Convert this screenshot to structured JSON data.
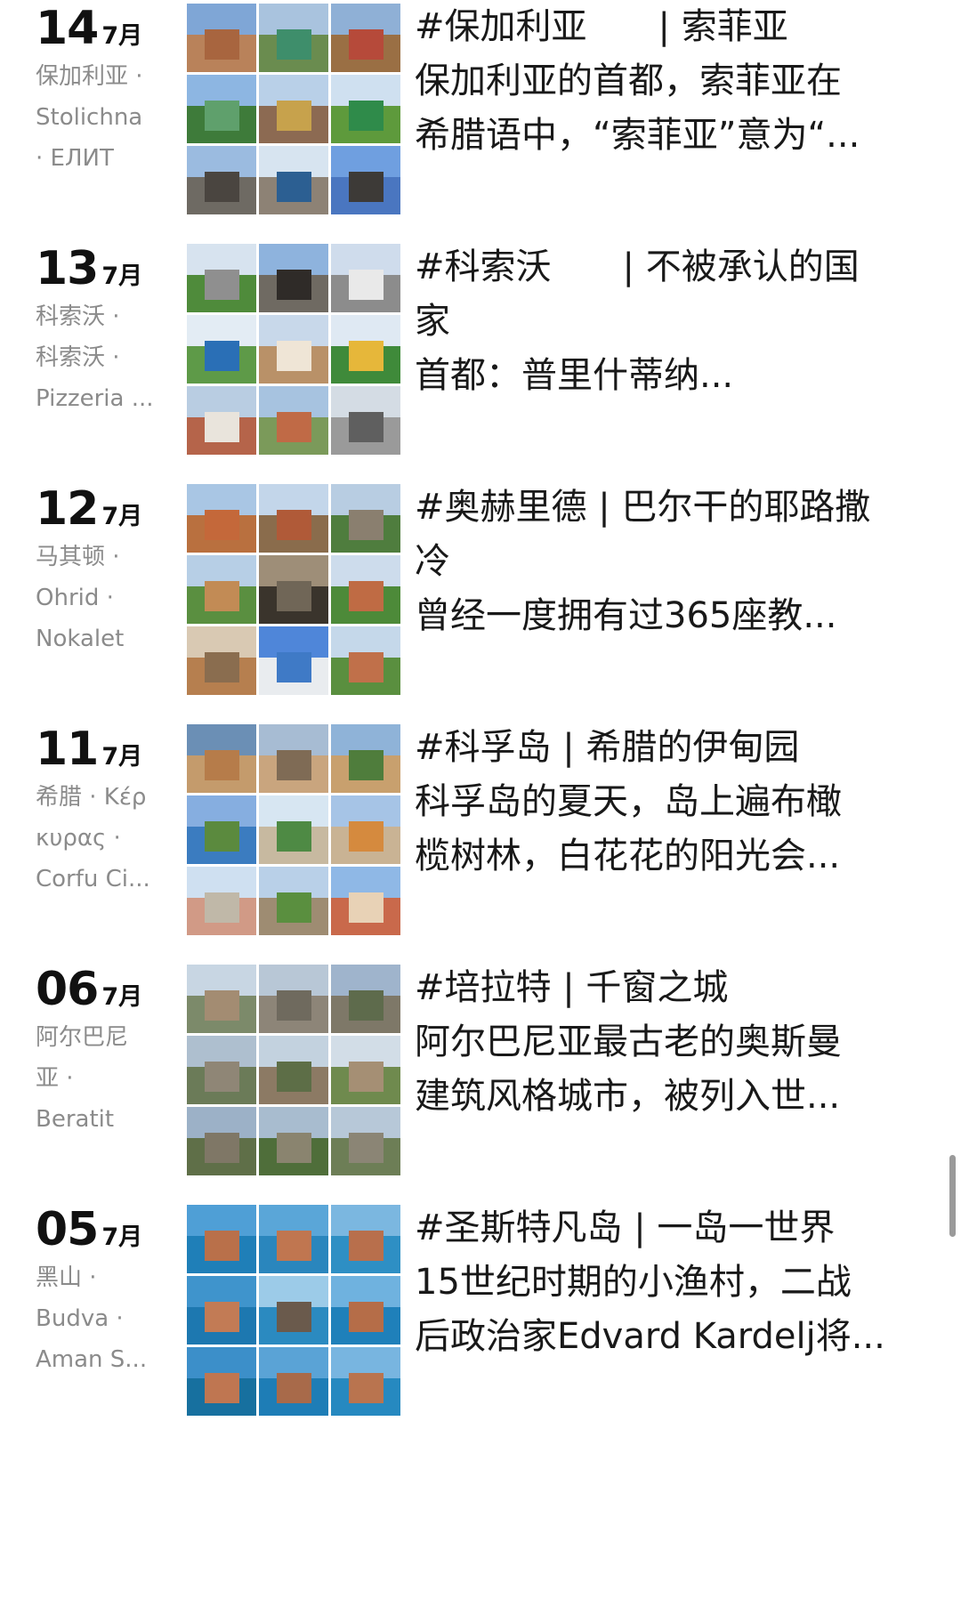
{
  "entries": [
    {
      "day": "14",
      "month": "7月",
      "location_lines": [
        "保加利亚 ·",
        "Stolichna",
        "· ЕЛИТ"
      ],
      "text_lines": [
        "#保加利亚　　| 索菲亚",
        "保加利亚的首都，索菲亚在",
        "希腊语中，“索菲亚”意为“..."
      ],
      "thumb_palette": [
        [
          "#7fa6d6",
          "#b9825a",
          "#a8653f"
        ],
        [
          "#a9c3de",
          "#6a8c4f",
          "#3e8e6b"
        ],
        [
          "#8fb0d6",
          "#9a6f44",
          "#b64a3a"
        ],
        [
          "#8db6e2",
          "#3e7b3a",
          "#5fa06c"
        ],
        [
          "#b9d0e8",
          "#8c6a52",
          "#c7a24c"
        ],
        [
          "#cfe0f0",
          "#5e9a3c",
          "#2f8b4a"
        ],
        [
          "#9bbbe0",
          "#6e6a63",
          "#4a4540"
        ],
        [
          "#d7e4f0",
          "#8d8275",
          "#2c5f92"
        ],
        [
          "#6f9fe0",
          "#4a76c0",
          "#3d3a37"
        ]
      ]
    },
    {
      "day": "13",
      "month": "7月",
      "location_lines": [
        "科索沃 ·",
        "科索沃 ·",
        "Pizzeria ..."
      ],
      "text_lines": [
        "#科索沃　　| 不被承认的国",
        "家",
        "首都：普里什蒂纳..."
      ],
      "thumb_palette": [
        [
          "#d7e3ef",
          "#4f8b3b",
          "#8f8f8f"
        ],
        [
          "#8eb3dd",
          "#6f6a62",
          "#2f2b28"
        ],
        [
          "#cfdcec",
          "#8c8c8c",
          "#e9e9e9"
        ],
        [
          "#e3ecf4",
          "#5e9a48",
          "#2a6fb6"
        ],
        [
          "#c8d8ea",
          "#b99168",
          "#efe5d6"
        ],
        [
          "#dfe9f3",
          "#3f8a3a",
          "#e6b73a"
        ],
        [
          "#b9cde2",
          "#b5644a",
          "#e9e4dc"
        ],
        [
          "#a7c3e0",
          "#7b9a5a",
          "#c06a46"
        ],
        [
          "#d4dce4",
          "#9a9a9a",
          "#5f5f5f"
        ]
      ]
    },
    {
      "day": "12",
      "month": "7月",
      "location_lines": [
        "马其顿 ·",
        "Ohrid ·",
        "Nokalet"
      ],
      "text_lines": [
        "#奥赫里德 | 巴尔干的耶路撒",
        "冷",
        "曾经一度拥有过365座教..."
      ],
      "thumb_palette": [
        [
          "#a9c6e4",
          "#b9703f",
          "#c4683a"
        ],
        [
          "#c3d6ea",
          "#8a6c4c",
          "#b05a38"
        ],
        [
          "#b8cde2",
          "#4f7d3e",
          "#8a7f6f"
        ],
        [
          "#b7cfe6",
          "#5a8f40",
          "#c28b55"
        ],
        [
          "#9e8e78",
          "#3a342c",
          "#706657"
        ],
        [
          "#cddcec",
          "#4d8a39",
          "#bf6b44"
        ],
        [
          "#d9c9b3",
          "#b67f4f",
          "#8a6d4f"
        ],
        [
          "#4f86d9",
          "#e9ecef",
          "#3f7ac6"
        ],
        [
          "#c5d8ea",
          "#5a8f3f",
          "#c0704a"
        ]
      ]
    },
    {
      "day": "11",
      "month": "7月",
      "location_lines": [
        "希腊 · Κέρ",
        "κυρας ·",
        "Corfu Ci..."
      ],
      "text_lines": [
        "#科孚岛 | 希腊的伊甸园",
        "科孚岛的夏天，岛上遍布橄",
        "榄树林，白花花的阳光会..."
      ],
      "thumb_palette": [
        [
          "#6b8fb5",
          "#c49b6c",
          "#b67c4a"
        ],
        [
          "#a7bcd3",
          "#c9a57e",
          "#7f6b55"
        ],
        [
          "#8fb3d8",
          "#c8a06e",
          "#4f7d3c"
        ],
        [
          "#86aee0",
          "#3b7cc0",
          "#5b8a3e"
        ],
        [
          "#d7e6f2",
          "#c7b9a0",
          "#4e8a44"
        ],
        [
          "#a6c4e6",
          "#c9b394",
          "#d58a3e"
        ],
        [
          "#cfe0f1",
          "#d19a86",
          "#c0b8a8"
        ],
        [
          "#b9d0e8",
          "#9e8c72",
          "#5a8f3f"
        ],
        [
          "#8fb8e6",
          "#c9694b",
          "#e8d2b6"
        ]
      ]
    },
    {
      "day": "06",
      "month": "7月",
      "location_lines": [
        "阿尔巴尼",
        "亚 ·",
        "Beratit"
      ],
      "text_lines": [
        "#培拉特 | 千窗之城",
        "阿尔巴尼亚最古老的奥斯曼",
        "建筑风格城市，被列入世..."
      ],
      "thumb_palette": [
        [
          "#c8d6e3",
          "#7c8a6a",
          "#a38c72"
        ],
        [
          "#b8c7d6",
          "#8d8578",
          "#6f6a5e"
        ],
        [
          "#9fb4cc",
          "#7e7868",
          "#5e6b4c"
        ],
        [
          "#aebfcf",
          "#6b7b58",
          "#8f8676"
        ],
        [
          "#c3d2df",
          "#8c7a64",
          "#5d6e47"
        ],
        [
          "#d2dde7",
          "#6f8a4e",
          "#a58f74"
        ],
        [
          "#9cb1c7",
          "#5f6f48",
          "#7f7766"
        ],
        [
          "#a8bccf",
          "#4f6e3a",
          "#8a846f"
        ],
        [
          "#b7c8d8",
          "#6d7e56",
          "#8b8575"
        ]
      ]
    },
    {
      "day": "05",
      "month": "7月",
      "location_lines": [
        "黑山 ·",
        "Budva ·",
        "Aman S..."
      ],
      "text_lines": [
        "#圣斯特凡岛 | 一岛一世界",
        "15世纪时期的小渔村，二战",
        "后政治家Edvard Kardelj将..."
      ],
      "thumb_palette": [
        [
          "#4f9fd6",
          "#1f7fb8",
          "#b9704a"
        ],
        [
          "#5aa6d8",
          "#2a86bd",
          "#c07650"
        ],
        [
          "#7bb7e0",
          "#2e8fc4",
          "#b86f4c"
        ],
        [
          "#3f94cc",
          "#1d78b0",
          "#c27b55"
        ],
        [
          "#9ccbe8",
          "#2b8ac0",
          "#6a5a4c"
        ],
        [
          "#6fb2df",
          "#1f80ba",
          "#b56d48"
        ],
        [
          "#3c8fc9",
          "#17709f",
          "#bf7651"
        ],
        [
          "#5aa3d6",
          "#1e7db6",
          "#a86a4a"
        ],
        [
          "#78b5e0",
          "#2689c0",
          "#b9744f"
        ]
      ]
    }
  ]
}
